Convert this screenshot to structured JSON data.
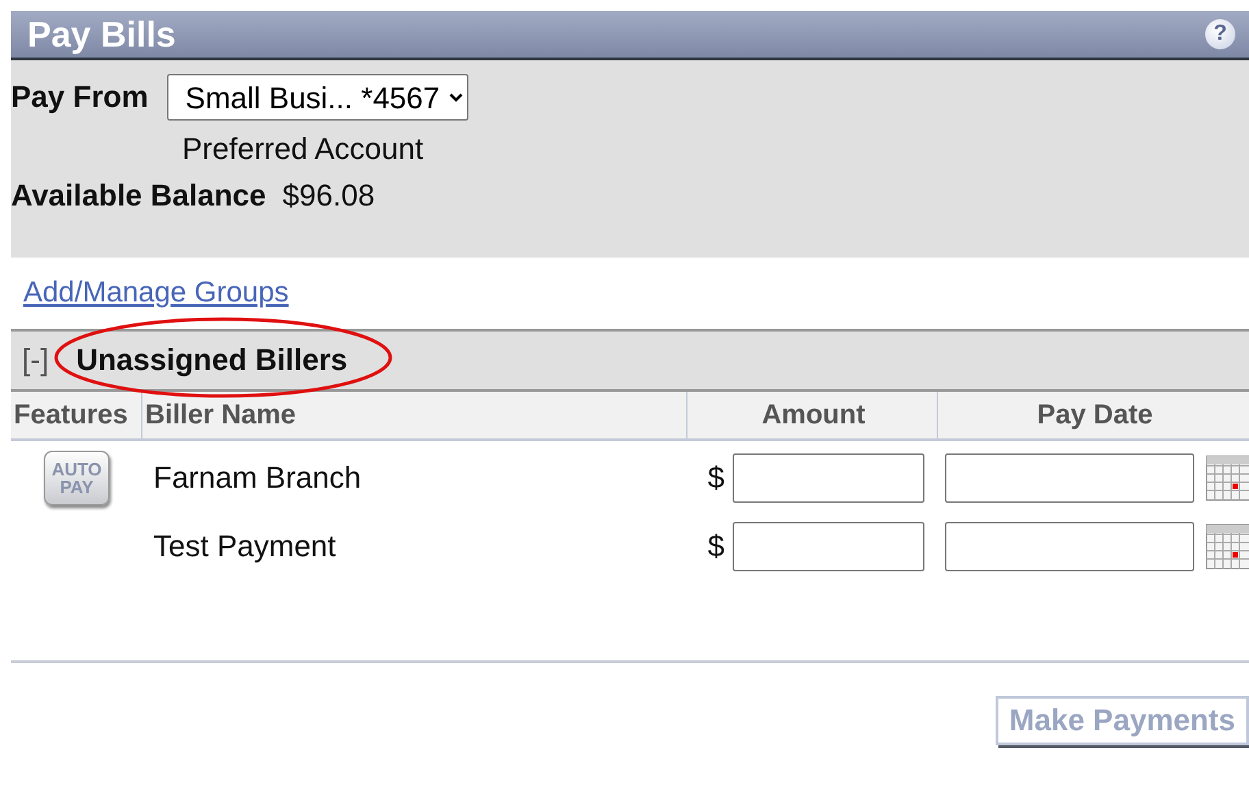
{
  "header": {
    "title": "Pay Bills",
    "help": "?"
  },
  "account": {
    "label": "Pay From",
    "selected_account": "Small Busi... *4567",
    "note": "Preferred Account",
    "balance_label": "Available Balance",
    "balance": "$96.08"
  },
  "manage_link": "Add/Manage Groups",
  "group": {
    "toggle": "[-]",
    "title": "Unassigned Billers",
    "expanded": true,
    "highlighted": true
  },
  "table": {
    "columns": [
      "Features",
      "Biller Name",
      "Amount",
      "Pay Date"
    ],
    "rows": [
      {
        "autopay": true,
        "biller": "Farnam Branch",
        "currency": "$"
      },
      {
        "autopay": false,
        "biller": "Test Payment",
        "currency": "$"
      }
    ]
  },
  "autopay_badge": [
    "AUTO",
    "PAY"
  ],
  "submit": {
    "label": "Make Payments",
    "disabled": true
  }
}
